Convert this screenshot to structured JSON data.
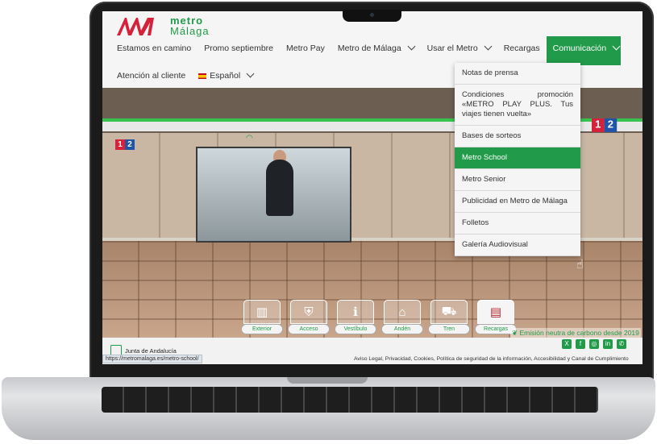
{
  "logo": {
    "line1": "metro",
    "line2": "Málaga"
  },
  "nav": {
    "row1": [
      {
        "label": "Estamos en camino",
        "has_chevron": false
      },
      {
        "label": "Promo septiembre",
        "has_chevron": false
      },
      {
        "label": "Metro Pay",
        "has_chevron": false
      },
      {
        "label": "Metro de Málaga",
        "has_chevron": true
      },
      {
        "label": "Usar el Metro",
        "has_chevron": true
      },
      {
        "label": "Recargas",
        "has_chevron": false
      },
      {
        "label": "Comunicación",
        "has_chevron": true,
        "active": true
      }
    ],
    "row2": [
      {
        "label": "Atención al cliente"
      },
      {
        "label": "Español",
        "flag": "es"
      }
    ]
  },
  "dropdown": {
    "items": [
      "Notas de prensa",
      "Condiciones promoción «METRO PLAY PLUS. Tus viajes tienen vuelta»",
      "Bases de sorteos",
      "Metro School",
      "Metro Senior",
      "Publicidad en Metro de Málaga",
      "Folletos",
      "Galería Audiovisual"
    ],
    "selected": "Metro School"
  },
  "line_badges": [
    "1",
    "2"
  ],
  "stations": [
    {
      "label": "Exterior",
      "icon": "building-icon"
    },
    {
      "label": "Acceso",
      "icon": "turnstile-icon"
    },
    {
      "label": "Vestíbulo",
      "icon": "info-icon"
    },
    {
      "label": "Andén",
      "icon": "platform-icon"
    },
    {
      "label": "Tren",
      "icon": "train-icon"
    },
    {
      "label": "Recargas",
      "icon": "ticket-machine-icon",
      "selected": true
    }
  ],
  "carbon_text": "Emisión neutra de carbono desde 2019",
  "footer": {
    "junta": "Junta de Andalucía",
    "status_url": "https://metromalaga.es/metro-school/",
    "legal": "Aviso Legal, Privacidad, Cookies, Política de seguridad de la información, Accesibilidad y Canal de Cumplimiento",
    "social": [
      "x-icon",
      "facebook-icon",
      "instagram-icon",
      "linkedin-icon",
      "whatsapp-icon"
    ]
  },
  "colors": {
    "brand_green": "#219a49",
    "logo_red": "#d6213a",
    "line1": "#d6213a",
    "line2": "#1f55a8"
  }
}
